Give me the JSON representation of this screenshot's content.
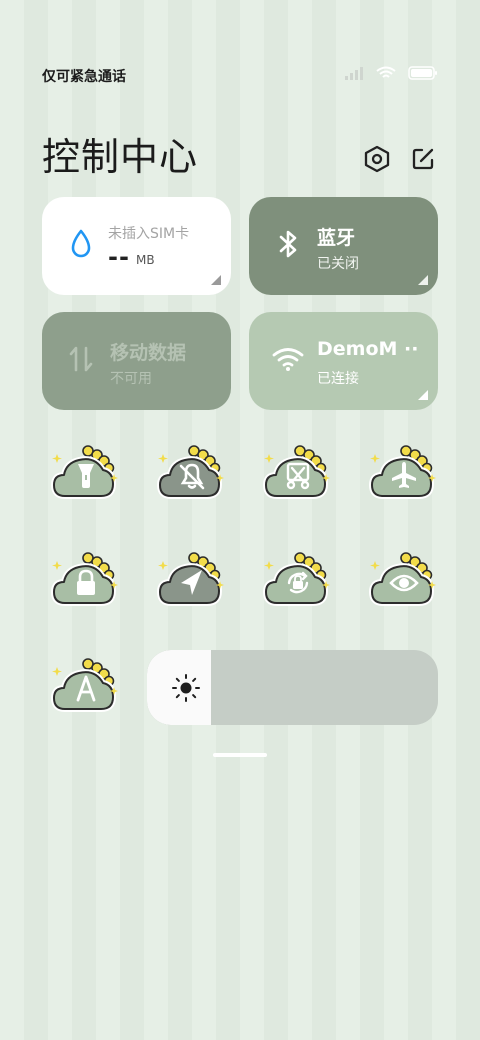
{
  "status_bar": {
    "carrier_text": "仅可紧急通话",
    "icons": [
      "signal-icon",
      "wifi-icon",
      "battery-icon"
    ]
  },
  "header": {
    "title": "控制中心",
    "settings_icon": "settings-hexagon-icon",
    "edit_icon": "edit-icon"
  },
  "tiles": {
    "sim": {
      "label": "未插入SIM卡",
      "value": "--",
      "unit": "MB",
      "icon": "water-drop-icon"
    },
    "bluetooth": {
      "label": "蓝牙",
      "status": "已关闭",
      "icon": "bluetooth-icon"
    },
    "mobile_data": {
      "label": "移动数据",
      "status": "不可用",
      "icon": "data-arrows-icon"
    },
    "wifi": {
      "label": "DemoM",
      "label_suffix": "··",
      "status": "已连接",
      "icon": "wifi-icon"
    }
  },
  "toggles": [
    {
      "name": "flashlight",
      "icon": "flashlight-icon",
      "active": false
    },
    {
      "name": "mute",
      "icon": "bell-off-icon",
      "active": true
    },
    {
      "name": "screenshot",
      "icon": "scissors-icon",
      "active": false
    },
    {
      "name": "airplane-mode",
      "icon": "airplane-icon",
      "active": false
    },
    {
      "name": "lock-screen",
      "icon": "lock-icon",
      "active": false
    },
    {
      "name": "location",
      "icon": "location-arrow-icon",
      "active": true
    },
    {
      "name": "rotation-lock",
      "icon": "rotation-lock-icon",
      "active": false
    },
    {
      "name": "reading-mode",
      "icon": "eye-icon",
      "active": false
    },
    {
      "name": "auto-brightness",
      "icon": "letter-a-icon",
      "active": false
    }
  ],
  "brightness": {
    "icon": "sun-icon",
    "level": 0.22
  },
  "colors": {
    "background": "#e6efe6",
    "tile_dark": "#7f907c",
    "tile_disabled": "#8e9f8c",
    "tile_light": "#b5c9b2",
    "accent_blue": "#2196f3",
    "cloud_light": "#a8bea5",
    "cloud_dark": "#8a958a",
    "spike_yellow": "#f2dc4a"
  }
}
